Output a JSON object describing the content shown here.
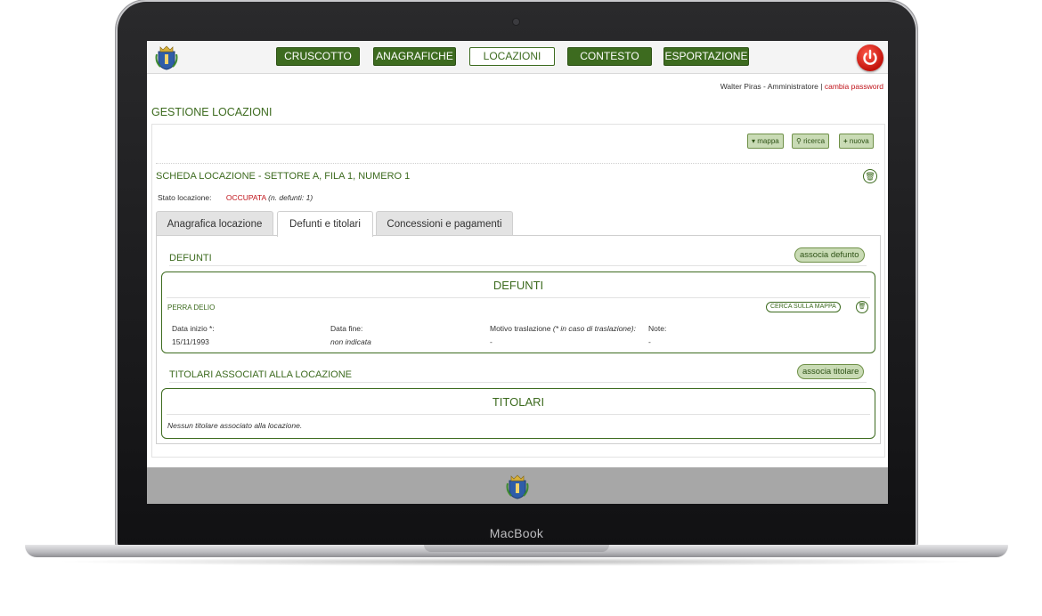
{
  "device": {
    "label": "MacBook"
  },
  "colors": {
    "accent": "#3d6b1f",
    "alert": "#c0141b",
    "footer": "#a7a7a7"
  },
  "nav": {
    "items": [
      {
        "label": "CRUSCOTTO",
        "active": false
      },
      {
        "label": "ANAGRAFICHE",
        "active": false
      },
      {
        "label": "LOCAZIONI",
        "active": true
      },
      {
        "label": "CONTESTO",
        "active": false
      },
      {
        "label": "ESPORTAZIONE",
        "active": false
      }
    ],
    "logo_icon": "coat-of-arms-icon",
    "logout_icon": "power-icon"
  },
  "user": {
    "name_role": "Walter Piras - Amministratore |",
    "change_password": "cambia password"
  },
  "page": {
    "title": "GESTIONE LOCAZIONI"
  },
  "toolbar": {
    "mappa": "mappa",
    "ricerca": "ricerca",
    "nuova": "nuova"
  },
  "scheda": {
    "title": "SCHEDA LOCAZIONE - SETTORE A, FILA 1, NUMERO 1",
    "stato_label": "Stato locazione:",
    "stato_value": "OCCUPATA",
    "stato_note": "(n. defunti: 1)"
  },
  "tabs": [
    {
      "label": "Anagrafica locazione",
      "active": false
    },
    {
      "label": "Defunti e titolari",
      "active": true
    },
    {
      "label": "Concessioni e pagamenti",
      "active": false
    }
  ],
  "defunti": {
    "section_title": "DEFUNTI",
    "associa_label": "associa defunto",
    "box_title": "DEFUNTI",
    "entry": {
      "name": "PERRA DELIO",
      "map_label": "CERCA SULLA MAPPA",
      "data_inizio_label": "Data inizio *:",
      "data_inizio_value": "15/11/1993",
      "data_fine_label": "Data fine:",
      "data_fine_value": "non indicata",
      "motivo_label": "Motivo traslazione",
      "motivo_hint": "(* in caso di traslazione):",
      "motivo_value": "-",
      "note_label": "Note:",
      "note_value": "-"
    }
  },
  "titolari": {
    "section_title": "TITOLARI ASSOCIATI ALLA LOCAZIONE",
    "associa_label": "associa titolare",
    "box_title": "TITOLARI",
    "empty_text": "Nessun titolare associato alla locazione."
  }
}
